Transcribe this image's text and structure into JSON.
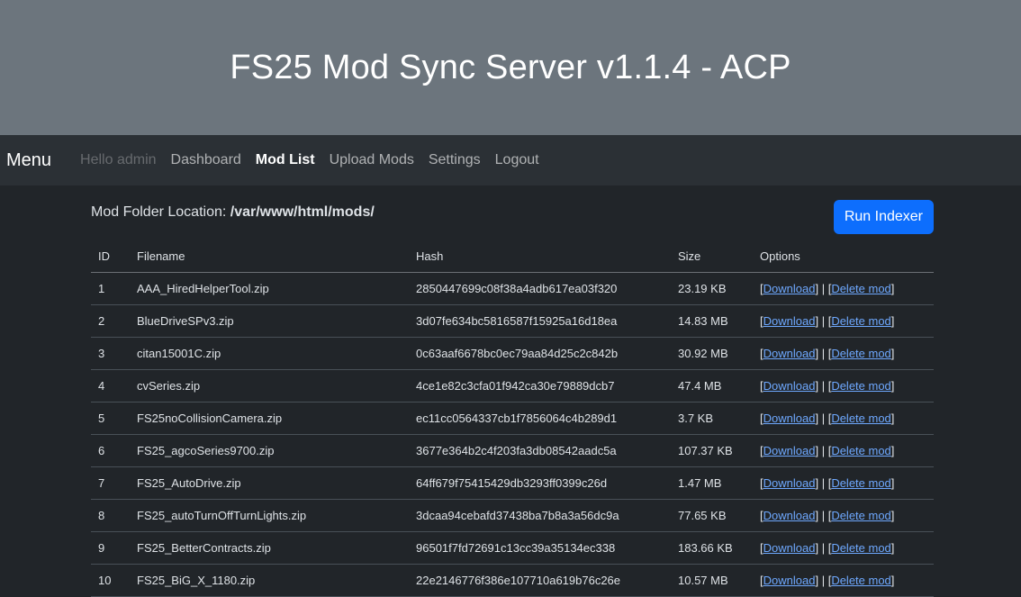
{
  "header": {
    "title": "FS25 Mod Sync Server v1.1.4 - ACP"
  },
  "navbar": {
    "brand": "Menu",
    "greeting": "Hello admin",
    "items": [
      {
        "label": "Dashboard",
        "name": "nav-dashboard",
        "state": "normal"
      },
      {
        "label": "Mod List",
        "name": "nav-mod-list",
        "state": "active"
      },
      {
        "label": "Upload Mods",
        "name": "nav-upload-mods",
        "state": "normal"
      },
      {
        "label": "Settings",
        "name": "nav-settings",
        "state": "normal"
      },
      {
        "label": "Logout",
        "name": "nav-logout",
        "state": "normal"
      }
    ]
  },
  "main": {
    "folder_label": "Mod Folder Location:",
    "folder_path": "/var/www/html/mods/",
    "run_indexer_label": "Run Indexer"
  },
  "table": {
    "headers": [
      "ID",
      "Filename",
      "Hash",
      "Size",
      "Options"
    ],
    "options": {
      "download": "Download",
      "separator": "|",
      "delete": "Delete mod"
    },
    "rows": [
      {
        "id": "1",
        "filename": "AAA_HiredHelperTool.zip",
        "hash": "2850447699c08f38a4adb617ea03f320",
        "size": "23.19 KB"
      },
      {
        "id": "2",
        "filename": "BlueDriveSPv3.zip",
        "hash": "3d07fe634bc5816587f15925a16d18ea",
        "size": "14.83 MB"
      },
      {
        "id": "3",
        "filename": "citan15001C.zip",
        "hash": "0c63aaf6678bc0ec79aa84d25c2c842b",
        "size": "30.92 MB"
      },
      {
        "id": "4",
        "filename": "cvSeries.zip",
        "hash": "4ce1e82c3cfa01f942ca30e79889dcb7",
        "size": "47.4 MB"
      },
      {
        "id": "5",
        "filename": "FS25noCollisionCamera.zip",
        "hash": "ec11cc0564337cb1f7856064c4b289d1",
        "size": "3.7 KB"
      },
      {
        "id": "6",
        "filename": "FS25_agcoSeries9700.zip",
        "hash": "3677e364b2c4f203fa3db08542aadc5a",
        "size": "107.37 KB"
      },
      {
        "id": "7",
        "filename": "FS25_AutoDrive.zip",
        "hash": "64ff679f75415429db3293ff0399c26d",
        "size": "1.47 MB"
      },
      {
        "id": "8",
        "filename": "FS25_autoTurnOffTurnLights.zip",
        "hash": "3dcaa94cebafd37438ba7b8a3a56dc9a",
        "size": "77.65 KB"
      },
      {
        "id": "9",
        "filename": "FS25_BetterContracts.zip",
        "hash": "96501f7fd72691c13cc39a35134ec338",
        "size": "183.66 KB"
      },
      {
        "id": "10",
        "filename": "FS25_BiG_X_1180.zip",
        "hash": "22e2146776f386e107710a619b76c26e",
        "size": "10.57 MB"
      }
    ]
  },
  "colors": {
    "header_bg": "#6c757d",
    "navbar_bg": "#2b3035",
    "page_bg": "#212529",
    "primary": "#0d6efd",
    "link": "#6ea8fe"
  }
}
